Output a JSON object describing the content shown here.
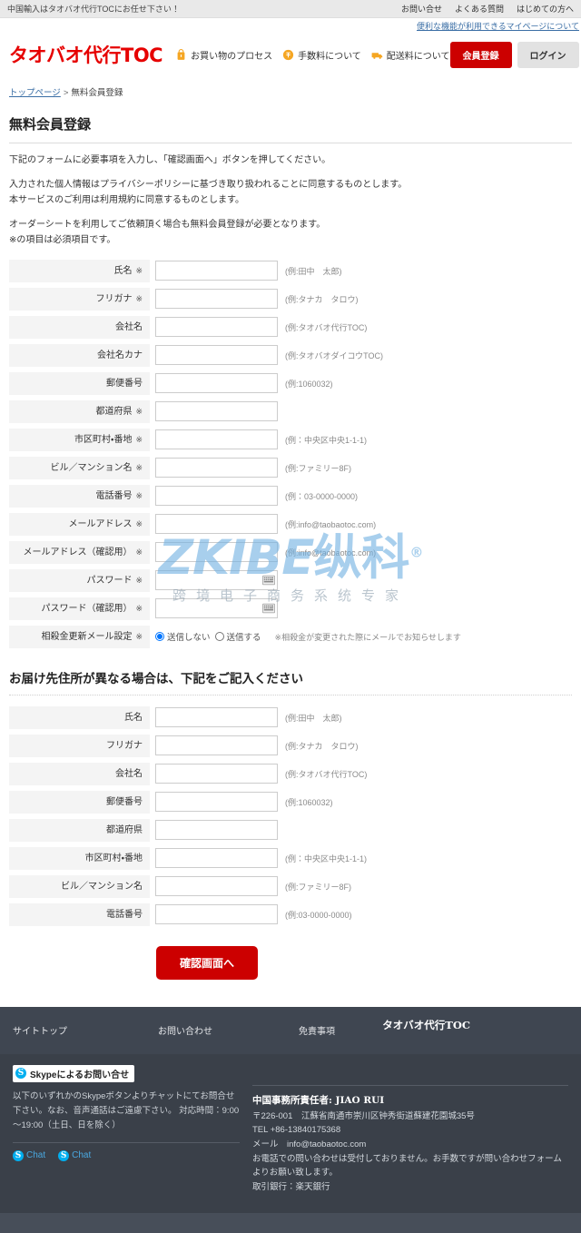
{
  "topbar": {
    "tagline": "中国輸入はタオバオ代行TOCにお任せ下さい！",
    "links": [
      {
        "label": "お問い合せ"
      },
      {
        "label": "よくある質問"
      },
      {
        "label": "はじめての方へ"
      }
    ]
  },
  "sublink": {
    "label": "便利な機能が利用できるマイページについて"
  },
  "header": {
    "logo": "タオバオ代行TOC",
    "nav": [
      {
        "label": "お買い物のプロセス",
        "icon": "shopping-bag-icon"
      },
      {
        "label": "手数料について",
        "icon": "coin-icon"
      },
      {
        "label": "配送料について",
        "icon": "truck-icon"
      }
    ],
    "register_label": "会員登録",
    "login_label": "ログイン"
  },
  "breadcrumb": {
    "home": "トップページ",
    "separator": ">",
    "current": "無料会員登録"
  },
  "page_title": "無料会員登録",
  "intro": {
    "p1": "下記のフォームに必要事項を入力し、「確認画面へ」ボタンを押してください。",
    "p2a": "入力された個人情報はプライバシーポリシーに基づき取り扱われることに同意するものとします。",
    "p2b": "本サービスのご利用は利用規約に同意するものとします。",
    "p3a": "オーダーシートを利用してご依頼頂く場合も無料会員登録が必要となります。",
    "p3b": "※の項目は必須項目です。"
  },
  "form_main": {
    "rows": [
      {
        "label": "氏名",
        "required": "※",
        "value": "",
        "hint": "(例:田中　太郎)",
        "type": "text"
      },
      {
        "label": "フリガナ",
        "required": "※",
        "value": "",
        "hint": "(例:タナカ　タロウ)",
        "type": "text"
      },
      {
        "label": "会社名",
        "required": "",
        "value": "",
        "hint": "(例:タオバオ代行TOC)",
        "type": "text"
      },
      {
        "label": "会社名カナ",
        "required": "",
        "value": "",
        "hint": "(例:タオバオダイコウTOC)",
        "type": "text"
      },
      {
        "label": "郵便番号",
        "required": "",
        "value": "",
        "hint": "(例:1060032)",
        "type": "text"
      },
      {
        "label": "都道府県",
        "required": "※",
        "value": "",
        "hint": "",
        "type": "text"
      },
      {
        "label": "市区町村・番地",
        "required": "※",
        "value": "",
        "hint": "(例：中央区中央1-1-1)",
        "type": "text"
      },
      {
        "label": "ビル／マンション名",
        "required": "※",
        "value": "",
        "hint": "(例:ファミリー8F)",
        "type": "text"
      },
      {
        "label": "電話番号",
        "required": "※",
        "value": "",
        "hint": "(例：03-0000-0000)",
        "type": "text"
      },
      {
        "label": "メールアドレス",
        "required": "※",
        "value": "",
        "hint": "(例:info@taobaotoc.com)",
        "type": "text"
      },
      {
        "label": "メールアドレス（確認用）",
        "required": "※",
        "value": "",
        "hint": "(例:info@taobaotoc.com)",
        "type": "text"
      },
      {
        "label": "パスワード",
        "required": "※",
        "value": "",
        "hint": "",
        "type": "password"
      },
      {
        "label": "パスワード（確認用）",
        "required": "※",
        "value": "",
        "hint": "",
        "type": "password"
      }
    ],
    "mail_setting": {
      "label": "相殺金更新メール設定",
      "required": "※",
      "option_off": "送信しない",
      "option_on": "送信する",
      "selected": "送信しない",
      "note": "※相殺金が変更された際にメールでお知らせします"
    }
  },
  "section2": {
    "title": "お届け先住所が異なる場合は、下記をご記入ください",
    "rows": [
      {
        "label": "氏名",
        "required": "",
        "value": "",
        "hint": "(例:田中　太郎)",
        "type": "text"
      },
      {
        "label": "フリガナ",
        "required": "",
        "value": "",
        "hint": "(例:タナカ　タロウ)",
        "type": "text"
      },
      {
        "label": "会社名",
        "required": "",
        "value": "",
        "hint": "(例:タオバオ代行TOC)",
        "type": "text"
      },
      {
        "label": "郵便番号",
        "required": "",
        "value": "",
        "hint": "(例:1060032)",
        "type": "text"
      },
      {
        "label": "都道府県",
        "required": "",
        "value": "",
        "hint": "",
        "type": "text"
      },
      {
        "label": "市区町村・番地",
        "required": "",
        "value": "",
        "hint": "(例：中央区中央1-1-1)",
        "type": "text"
      },
      {
        "label": "ビル／マンション名",
        "required": "",
        "value": "",
        "hint": "(例:ファミリー8F)",
        "type": "text"
      },
      {
        "label": "電話番号",
        "required": "",
        "value": "",
        "hint": "(例:03-0000-0000)",
        "type": "text"
      }
    ]
  },
  "submit": {
    "label": "確認画面へ"
  },
  "watermark": {
    "latin": "ZKIBE",
    "cn": "纵科",
    "registered": "®",
    "sub": "跨境电子商务系统专家"
  },
  "footer": {
    "nav": [
      {
        "label": "サイトトップ"
      },
      {
        "label": "お問い合わせ"
      },
      {
        "label": "免責事項"
      }
    ],
    "logo": "タオバオ代行TOC",
    "skype": {
      "badge": "Skypeによるお問い合せ",
      "badge_mark": "S",
      "desc": "以下のいずれかのSkypeボタンよりチャットにてお問合せ下さい。なお、音声通話はご遠慮下さい。 対応時間：9:00～19:00（土日、日を除く）",
      "chat1": "Chat",
      "chat2": "Chat"
    },
    "company": {
      "title": "中国事務所責任者: JIAO RUI",
      "address": "〒226-001　江蘇省南通市崇川区钟秀街道蘇建花園城35号",
      "tel": "TEL +86-13840175368",
      "mail": "メール　info@taobaotoc.com",
      "notice": "お電話での問い合わせは受付しておりません。お手数ですが問い合わせフォームよりお願い致します。",
      "bank": "取引銀行：楽天銀行"
    }
  },
  "colors": {
    "brand_red": "#cc0000",
    "logo_red": "#e60000",
    "accent_orange": "#f5a623",
    "link_blue": "#3a6ea5",
    "footer_dark": "#3a4049",
    "footer_top": "#3f4651"
  }
}
